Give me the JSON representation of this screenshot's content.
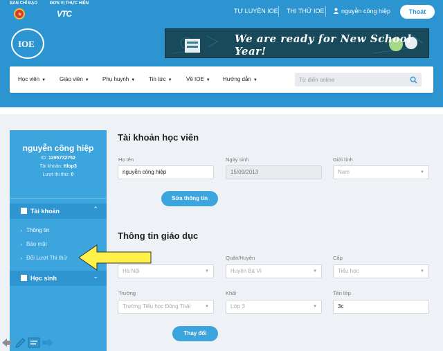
{
  "topbar": {
    "sponsor_1": "BAN CHỈ ĐẠO",
    "sponsor_2": "ĐƠN VỊ THỰC HIỆN",
    "sponsor_2_logo": "VTC",
    "links": [
      "TỰ LUYỆN IOE",
      "THI THỬ IOE"
    ],
    "username": "nguyễn công hiệp",
    "logout_label": "Thoát",
    "color": "#2c95d1"
  },
  "header": {
    "logo_text": "IOE",
    "banner_text": "We are ready for New School Year!"
  },
  "nav": {
    "items": [
      "Học viên",
      "Giáo viên",
      "Phụ huynh",
      "Tin tức",
      "Về IOE",
      "Hướng dẫn"
    ],
    "search_placeholder": "Từ điển online"
  },
  "sidebar": {
    "name": "nguyễn công hiệp",
    "id_label": "ID:",
    "id_value": "1295732752",
    "account_label": "Tài khoản:",
    "account_value": "ttlop3",
    "trials_label": "Lượt thi thử:",
    "trials_value": "0",
    "section_account": "Tài khoản",
    "sub_items": [
      "Thông tin",
      "Bảo mật",
      "Đổi Lượt Thi thử"
    ],
    "section_student": "Học sinh"
  },
  "account_form": {
    "title": "Tài khoản học viên",
    "name_label": "Họ tên",
    "name_value": "nguyễn công hiệp",
    "dob_label": "Ngày sinh",
    "dob_value": "15/09/2013",
    "gender_label": "Giới tính",
    "gender_value": "Nam",
    "edit_button": "Sửa thông tin"
  },
  "education_form": {
    "title": "Thông tin giáo dục",
    "province_value": "Hà Nội",
    "district_label": "Quận/Huyện",
    "district_value": "Huyện Ba Vì",
    "level_label": "Cấp",
    "level_value": "Tiểu học",
    "school_label": "Trường",
    "school_value": "Trường Tiểu học Đồng Thái",
    "grade_label": "Khối",
    "grade_value": "Lớp 3",
    "class_label": "Tên lớp",
    "class_value": "3c",
    "change_button": "Thay đổi"
  },
  "colors": {
    "primary": "#2c95d1",
    "sidebar": "#3da5de",
    "arrow": "#fff04a"
  }
}
